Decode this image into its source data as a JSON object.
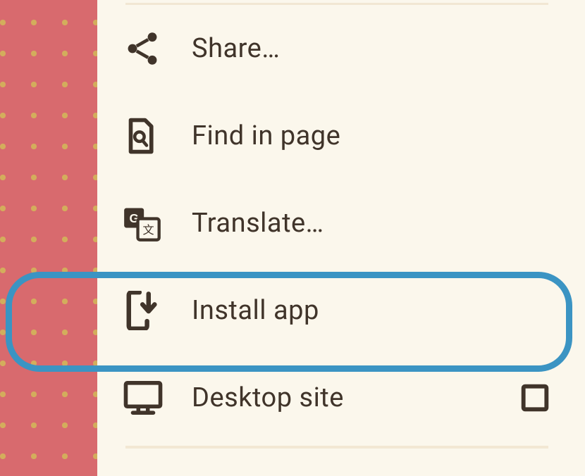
{
  "menu": {
    "items": [
      {
        "label": "Share…",
        "checkable": false
      },
      {
        "label": "Find in page",
        "checkable": false
      },
      {
        "label": "Translate…",
        "checkable": false
      },
      {
        "label": "Install app",
        "checkable": false
      },
      {
        "label": "Desktop site",
        "checkable": true
      }
    ]
  },
  "colors": {
    "bg_panel": "#fbf7ec",
    "icon_color": "#40342a",
    "highlight_border": "#3b94c3",
    "dots_bg": "#d86a6e",
    "dots_fill": "#d3ad5c"
  }
}
